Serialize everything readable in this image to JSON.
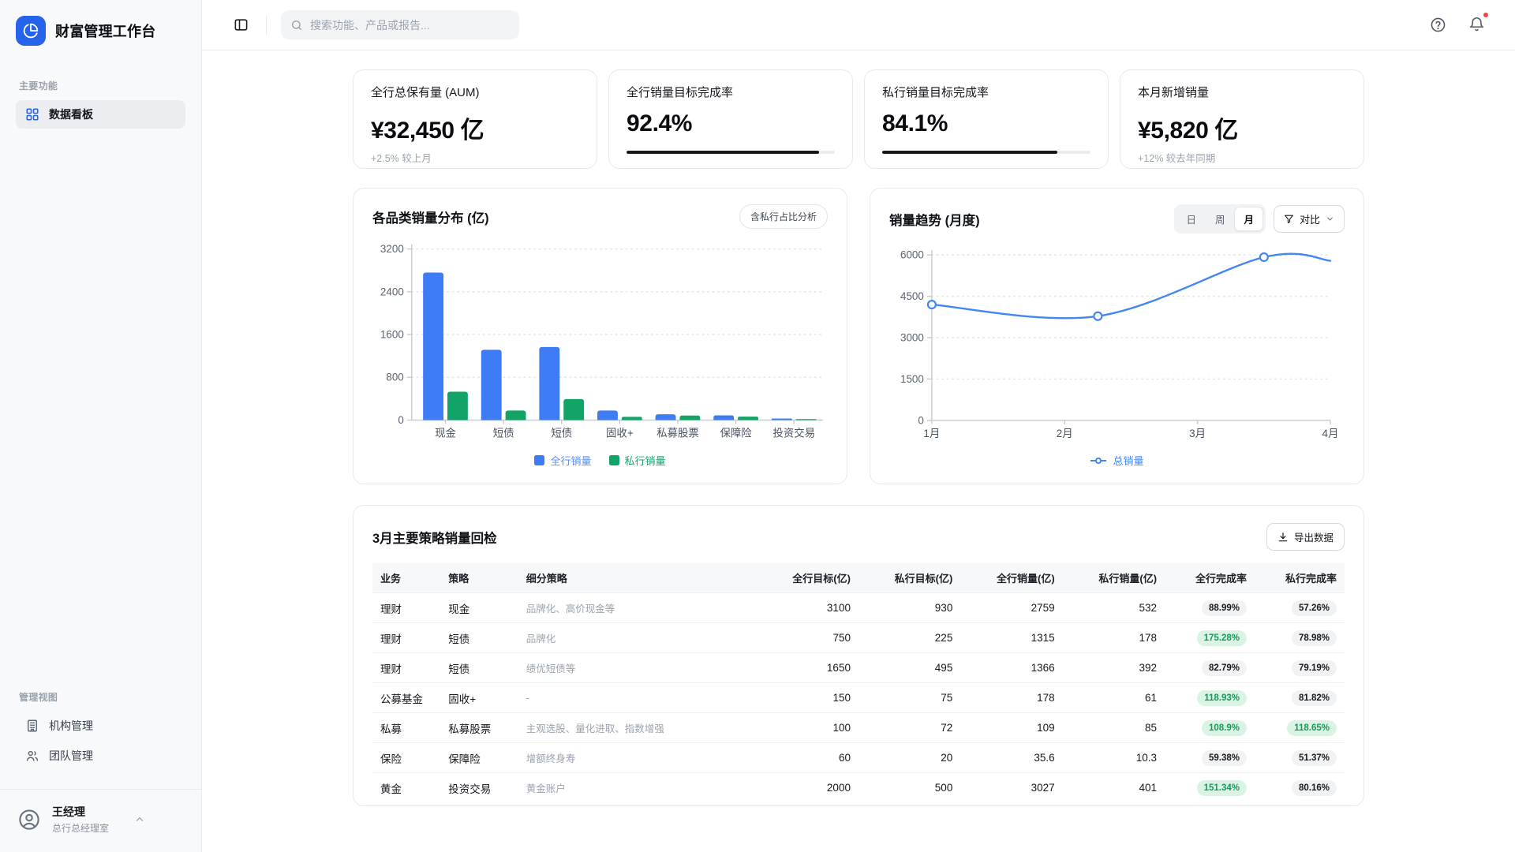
{
  "app": {
    "name": "财富管理工作台"
  },
  "header": {
    "search_placeholder": "搜索功能、产品或报告..."
  },
  "sidebar": {
    "sections": [
      {
        "label": "主要功能",
        "items": [
          {
            "label": "数据看板",
            "icon": "dashboard-icon",
            "active": true
          }
        ]
      },
      {
        "label": "管理视图",
        "items": [
          {
            "label": "机构管理",
            "icon": "building-icon",
            "active": false
          },
          {
            "label": "团队管理",
            "icon": "team-icon",
            "active": false
          }
        ]
      }
    ],
    "user": {
      "name": "王经理",
      "role": "总行总经理室"
    }
  },
  "kpis": [
    {
      "title": "全行总保有量 (AUM)",
      "value": "¥32,450 亿",
      "note": "+2.5% 较上月"
    },
    {
      "title": "全行销量目标完成率",
      "value": "92.4%",
      "progress_pct": 92.4
    },
    {
      "title": "私行销量目标完成率",
      "value": "84.1%",
      "progress_pct": 84.1
    },
    {
      "title": "本月新增销量",
      "value": "¥5,820 亿",
      "note": "+12% 较去年同期"
    }
  ],
  "chart_data": [
    {
      "type": "bar",
      "title": "各品类销量分布 (亿)",
      "badge": "含私行占比分析",
      "categories": [
        "现金",
        "短债",
        "短债",
        "固收+",
        "私募股票",
        "保障险",
        "投资交易"
      ],
      "series": [
        {
          "name": "全行销量",
          "color": "#3E7CF6",
          "values": [
            2759,
            1315,
            1366,
            178,
            109,
            88,
            30
          ]
        },
        {
          "name": "私行销量",
          "color": "#12A467",
          "values": [
            532,
            178,
            392,
            61,
            85,
            65,
            8
          ]
        }
      ],
      "ylim": [
        0,
        3200
      ],
      "yticks": [
        0,
        800,
        1600,
        2400,
        3200
      ],
      "grid": "dotted",
      "legend_position": "bottom"
    },
    {
      "type": "line",
      "title": "销量趋势 (月度)",
      "range_options": [
        "日",
        "周",
        "月"
      ],
      "range_active": "月",
      "compare_label": "对比",
      "x": [
        1,
        2.25,
        3.5,
        4
      ],
      "series": [
        {
          "name": "总销量",
          "color": "#4285F4",
          "values": [
            4200,
            3780,
            5920,
            5790
          ],
          "markers": [
            true,
            true,
            true,
            false
          ],
          "smooth": true
        }
      ],
      "xticks": [
        1,
        2,
        3,
        4
      ],
      "xtick_labels": [
        "1月",
        "2月",
        "3月",
        "4月"
      ],
      "ylim": [
        0,
        6000
      ],
      "yticks": [
        0,
        1500,
        3000,
        4500,
        6000
      ],
      "grid": "dotted",
      "legend_position": "bottom"
    }
  ],
  "table": {
    "title": "3月主要策略销量回检",
    "export_label": "导出数据",
    "columns": [
      {
        "label": "业务",
        "align": "left"
      },
      {
        "label": "策略",
        "align": "left"
      },
      {
        "label": "细分策略",
        "align": "left"
      },
      {
        "label": "全行目标(亿)",
        "align": "right"
      },
      {
        "label": "私行目标(亿)",
        "align": "right"
      },
      {
        "label": "全行销量(亿)",
        "align": "right"
      },
      {
        "label": "私行销量(亿)",
        "align": "right"
      },
      {
        "label": "全行完成率",
        "align": "right"
      },
      {
        "label": "私行完成率",
        "align": "right"
      }
    ],
    "rows": [
      {
        "cells": [
          "理财",
          "现金",
          "品牌化、高价现金等",
          "3100",
          "930",
          "2759",
          "532"
        ],
        "bank_rate": {
          "text": "88.99%",
          "green": false
        },
        "private_rate": {
          "text": "57.26%",
          "green": false
        }
      },
      {
        "cells": [
          "理财",
          "短债",
          "品牌化",
          "750",
          "225",
          "1315",
          "178"
        ],
        "bank_rate": {
          "text": "175.28%",
          "green": true
        },
        "private_rate": {
          "text": "78.98%",
          "green": false
        }
      },
      {
        "cells": [
          "理财",
          "短债",
          "绩优短债等",
          "1650",
          "495",
          "1366",
          "392"
        ],
        "bank_rate": {
          "text": "82.79%",
          "green": false
        },
        "private_rate": {
          "text": "79.19%",
          "green": false
        }
      },
      {
        "cells": [
          "公募基金",
          "固收+",
          "-",
          "150",
          "75",
          "178",
          "61"
        ],
        "bank_rate": {
          "text": "118.93%",
          "green": true
        },
        "private_rate": {
          "text": "81.82%",
          "green": false
        }
      },
      {
        "cells": [
          "私募",
          "私募股票",
          "主观选股、量化进取、指数增强",
          "100",
          "72",
          "109",
          "85"
        ],
        "bank_rate": {
          "text": "108.9%",
          "green": true
        },
        "private_rate": {
          "text": "118.65%",
          "green": true
        }
      },
      {
        "cells": [
          "保险",
          "保障险",
          "增额终身寿",
          "60",
          "20",
          "35.6",
          "10.3"
        ],
        "bank_rate": {
          "text": "59.38%",
          "green": false
        },
        "private_rate": {
          "text": "51.37%",
          "green": false
        }
      },
      {
        "cells": [
          "黄金",
          "投资交易",
          "黄金账户",
          "2000",
          "500",
          "3027",
          "401"
        ],
        "bank_rate": {
          "text": "151.34%",
          "green": true
        },
        "private_rate": {
          "text": "80.16%",
          "green": false
        }
      }
    ]
  },
  "colors": {
    "brand": "#2563eb",
    "bar_bank": "#3E7CF6",
    "bar_private": "#12A467",
    "line_total": "#4285F4",
    "notification_dot": "#ef4444",
    "badge_green_bg": "#d9f4e4",
    "badge_green_text": "#149a5c",
    "progress_fill": "#17181b"
  }
}
